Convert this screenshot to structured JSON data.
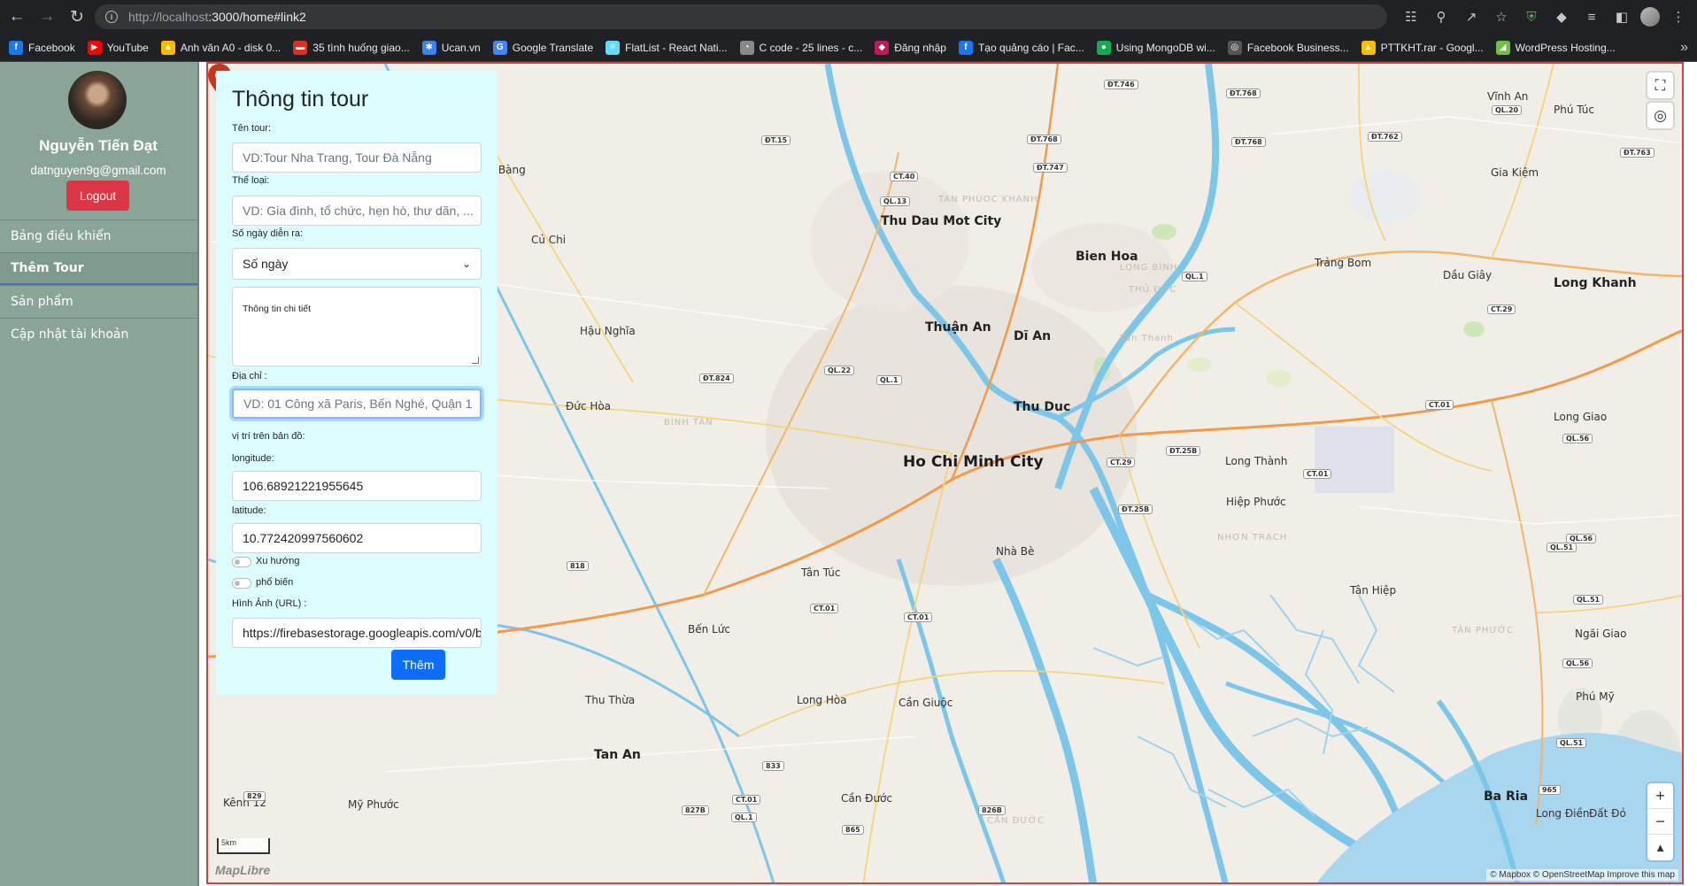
{
  "browser": {
    "url_host": "http://localhost",
    "url_path": ":3000/home#link2",
    "bookmarks": [
      {
        "label": "Facebook",
        "color": "#1877f2",
        "glyph": "f"
      },
      {
        "label": "YouTube",
        "color": "#ff0000",
        "glyph": "▶"
      },
      {
        "label": "Anh văn A0 - disk 0...",
        "color": "#fbbc04",
        "glyph": "▲"
      },
      {
        "label": "35 tình huống giao...",
        "color": "#d93025",
        "glyph": "▬"
      },
      {
        "label": "Ucan.vn",
        "color": "#3b82f6",
        "glyph": "✱"
      },
      {
        "label": "Google Translate",
        "color": "#4285f4",
        "glyph": "G"
      },
      {
        "label": "FlatList - React Nati...",
        "color": "#61dafb",
        "glyph": "⚛"
      },
      {
        "label": "C code - 25 lines - c...",
        "color": "#888888",
        "glyph": "◔"
      },
      {
        "label": "Đăng nhập",
        "color": "#c2185b",
        "glyph": "◆"
      },
      {
        "label": "Tạo quảng cáo | Fac...",
        "color": "#1877f2",
        "glyph": "f"
      },
      {
        "label": "Using MongoDB wi...",
        "color": "#13aa52",
        "glyph": "●"
      },
      {
        "label": "Facebook Business...",
        "color": "#555555",
        "glyph": "◎"
      },
      {
        "label": "PTTKHT.rar - Googl...",
        "color": "#fbbc04",
        "glyph": "▲"
      },
      {
        "label": "WordPress Hosting...",
        "color": "#6fbf44",
        "glyph": "◢"
      }
    ]
  },
  "sidebar": {
    "user_name": "Nguyễn Tiến Đạt",
    "user_email": "datnguyen9g@gmail.com",
    "logout_label": "Logout",
    "menu": [
      {
        "label": "Bảng điều khiển",
        "active": false
      },
      {
        "label": "Thêm Tour",
        "active": true
      },
      {
        "label": "Sản phẩm",
        "active": false
      },
      {
        "label": "Cập nhật tài khoản",
        "active": false
      }
    ]
  },
  "form": {
    "title": "Thông tin tour",
    "tour_name_label": "Tên tour:",
    "tour_name_placeholder": "VD:Tour Nha Trang, Tour Đà Nẵng",
    "category_label": "Thể loại:",
    "category_placeholder": "VD: Gia đình, tổ chức, hẹn hò, thư dãn, ...",
    "days_label": "Số ngày diễn ra:",
    "days_selected": "Số ngày",
    "details_placeholder": "Thông tin chi tiết",
    "address_label": "Địa chỉ :",
    "address_placeholder": "VD: 01 Công xã Paris, Bến Nghé, Quận 1",
    "map_position_label": "vị trí trên bản đồ:",
    "longitude_label": "longitude:",
    "longitude_value": "106.68921221955645",
    "latitude_label": "latitude:",
    "latitude_value": "10.772420997560602",
    "trend_label": "Xu hướng",
    "popular_label": "phổ biến",
    "image_label": "Hình Ảnh (URL) :",
    "image_value": "https://firebasestorage.googleapis.com/v0/b/",
    "submit_label": "Thêm"
  },
  "map": {
    "labels": [
      {
        "text": "Ho Chi Minh City",
        "kind": "big"
      },
      {
        "text": "Bien Hoa",
        "kind": "city"
      },
      {
        "text": "Thu Dau Mot City",
        "kind": "city"
      },
      {
        "text": "Thuận An",
        "kind": "city"
      },
      {
        "text": "Dĩ An",
        "kind": "city"
      },
      {
        "text": "Thu Duc",
        "kind": "city"
      },
      {
        "text": "Long Khanh",
        "kind": "city"
      },
      {
        "text": "Tan An",
        "kind": "city"
      },
      {
        "text": "Ba Ria",
        "kind": "city"
      },
      {
        "text": "Phú Túc",
        "kind": "town"
      },
      {
        "text": "Vĩnh An",
        "kind": "town"
      },
      {
        "text": "Gia Kiệm",
        "kind": "town"
      },
      {
        "text": "Trảng Bom",
        "kind": "town"
      },
      {
        "text": "Dầu Giây",
        "kind": "town"
      },
      {
        "text": "Long Giao",
        "kind": "town"
      },
      {
        "text": "Long Thành",
        "kind": "town"
      },
      {
        "text": "Hiệp Phước",
        "kind": "town"
      },
      {
        "text": "Nhà Bè",
        "kind": "town"
      },
      {
        "text": "Tân Túc",
        "kind": "town"
      },
      {
        "text": "Bến Lức",
        "kind": "town"
      },
      {
        "text": "Thu Thừa",
        "kind": "town"
      },
      {
        "text": "Long Hòa",
        "kind": "town"
      },
      {
        "text": "Cần Giuộc",
        "kind": "town"
      },
      {
        "text": "Cần Đước",
        "kind": "town"
      },
      {
        "text": "Đức Hòa",
        "kind": "town"
      },
      {
        "text": "Hậu Nghĩa",
        "kind": "town"
      },
      {
        "text": "Củ Chi",
        "kind": "town"
      },
      {
        "text": "Trảng Bàng",
        "kind": "town"
      },
      {
        "text": "Phú Mỹ",
        "kind": "town"
      },
      {
        "text": "Ngãi Giao",
        "kind": "town"
      },
      {
        "text": "Long Điền",
        "kind": "town"
      },
      {
        "text": "Đất Đỏ",
        "kind": "town"
      },
      {
        "text": "Mỹ Phước",
        "kind": "town"
      },
      {
        "text": "Kênh 12",
        "kind": "town"
      },
      {
        "text": "Tân Hiệp",
        "kind": "town"
      },
      {
        "text": "Tân Thanh",
        "kind": "district"
      },
      {
        "text": "THỦ ĐỨC",
        "kind": "district"
      },
      {
        "text": "BÌNH TÂN",
        "kind": "district"
      },
      {
        "text": "NHƠN TRẠCH",
        "kind": "district"
      },
      {
        "text": "TAN PHUOC KHANH",
        "kind": "district"
      },
      {
        "text": "LONG BÌNH",
        "kind": "district"
      },
      {
        "text": "CẦN ĐƯỚC",
        "kind": "district"
      },
      {
        "text": "TÂN PHƯỚC",
        "kind": "district"
      }
    ],
    "shields": [
      "ĐT.746",
      "ĐT.768",
      "QL.20",
      "ĐT.763",
      "ĐT.762",
      "ĐT.768",
      "CT.40",
      "QL.13",
      "ĐT.747",
      "ĐT.15",
      "QL.1",
      "CT.29",
      "QL.22",
      "ĐT.824",
      "QL.1",
      "CT.01",
      "QL.56",
      "ĐT.25B",
      "CT.29",
      "ĐT.25B",
      "CT.01",
      "CT.01",
      "CT.01",
      "QL.56",
      "QL.51",
      "QL.51",
      "QL.56",
      "QL.51",
      "965",
      "833",
      "826B",
      "827B",
      "865",
      "829",
      "CT.01",
      "QL.1",
      "818",
      "ĐT.768"
    ],
    "scale_label": "5km",
    "logo_label": "MapLibre",
    "attribution": "© Mapbox © OpenStreetMap  Improve this map"
  }
}
